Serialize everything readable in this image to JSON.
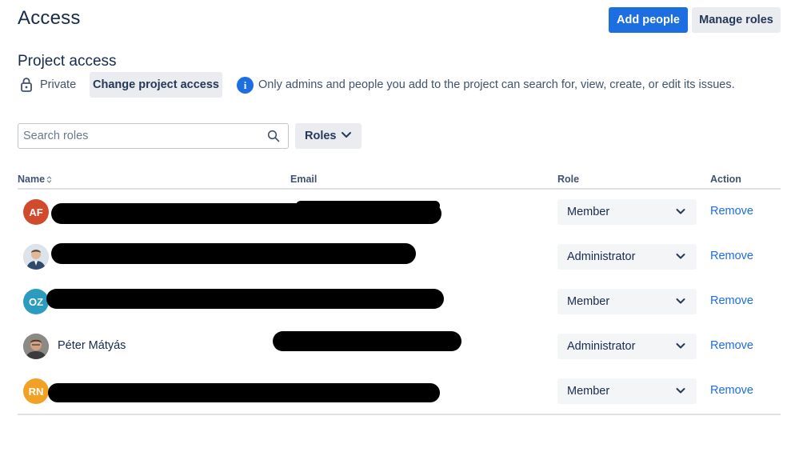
{
  "header": {
    "title": "Access",
    "add_people_label": "Add people",
    "manage_roles_label": "Manage roles",
    "accent_color": "#1d6ee0"
  },
  "project_access": {
    "title": "Project access",
    "visibility": "Private",
    "change_button_label": "Change project access",
    "info_text": "Only admins and people you add to the project can search for, view, create, or edit its issues."
  },
  "filters": {
    "search_placeholder": "Search roles",
    "search_value": "",
    "roles_dropdown_label": "Roles"
  },
  "table": {
    "columns": {
      "name": "Name",
      "email": "Email",
      "role": "Role",
      "action": "Action"
    },
    "rows": [
      {
        "avatar_type": "initials",
        "initials": "AF",
        "avatar_color": "#d04a2b",
        "name": "",
        "email": "",
        "role": "Member",
        "action": "Remove"
      },
      {
        "avatar_type": "photo",
        "initials": "",
        "avatar_color": "#c9d3de",
        "name": "",
        "email": "",
        "role": "Administrator",
        "action": "Remove"
      },
      {
        "avatar_type": "initials",
        "initials": "OZ",
        "avatar_color": "#2b9bbf",
        "name": "",
        "email": "",
        "role": "Member",
        "action": "Remove"
      },
      {
        "avatar_type": "photo",
        "initials": "",
        "avatar_color": "#7a6a5c",
        "name": "Péter Mátyás",
        "email": "",
        "role": "Administrator",
        "action": "Remove"
      },
      {
        "avatar_type": "initials",
        "initials": "RN",
        "avatar_color": "#f1a124",
        "name": "",
        "email": "",
        "role": "Member",
        "action": "Remove"
      }
    ]
  }
}
